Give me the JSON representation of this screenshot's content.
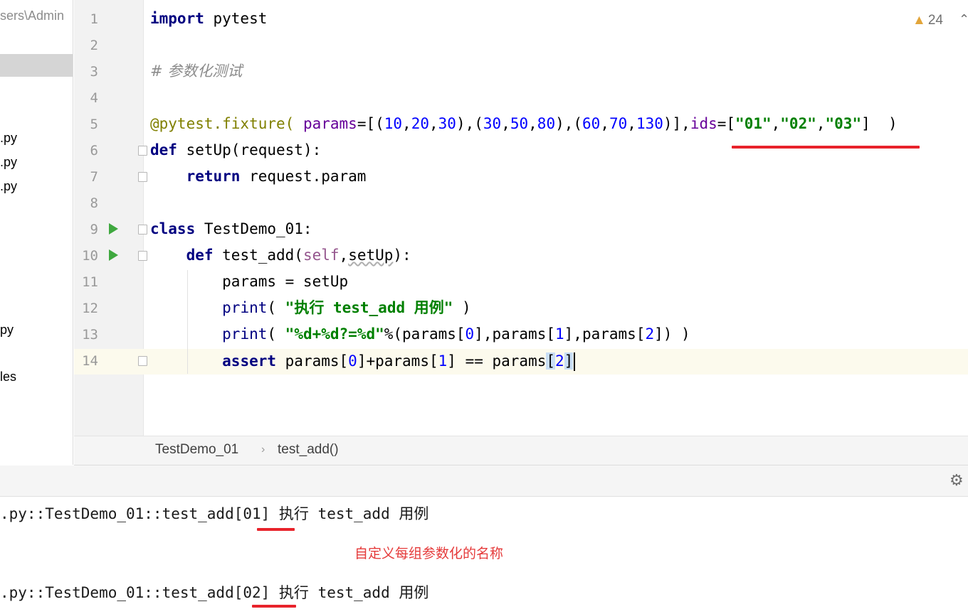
{
  "sidebar": {
    "path": "sers\\Admin",
    "items": [
      ".py",
      ".py",
      ".py",
      "py",
      "les"
    ]
  },
  "editor": {
    "line_numbers": [
      "1",
      "2",
      "3",
      "4",
      "5",
      "6",
      "7",
      "8",
      "9",
      "10",
      "11",
      "12",
      "13",
      "14"
    ],
    "code": {
      "line1": [
        "import",
        " pytest"
      ],
      "line3": "# 参数化测试",
      "line5": [
        "@pytest.fixture(",
        " params",
        "=[(",
        "10",
        ",",
        "20",
        ",",
        "30",
        "),(",
        "30",
        ",",
        "50",
        ",",
        "80",
        "),(",
        "60",
        ",",
        "70",
        ",",
        "130",
        ")],",
        "ids",
        "=[",
        "\"01\"",
        ",",
        "\"02\"",
        ",",
        "\"03\"",
        "]",
        "  )"
      ],
      "line6": [
        "def",
        " setUp(request):"
      ],
      "line7": [
        "    ",
        "return",
        " request.param"
      ],
      "line9": [
        "class",
        " TestDemo_01:"
      ],
      "line10": [
        "    ",
        "def",
        " test_add(",
        "self",
        ",",
        "setUp",
        "):"
      ],
      "line11": "        params = setUp",
      "line12": [
        "        ",
        "print",
        "( ",
        "\"执行 test_add 用例\"",
        " )"
      ],
      "line13": [
        "        ",
        "print",
        "( ",
        "\"%d+%d?=%d\"",
        "%(params[",
        "0",
        "],params[",
        "1",
        "],params[",
        "2",
        "]) )"
      ],
      "line14": [
        "        ",
        "assert",
        " params[",
        "0",
        "]+params[",
        "1",
        "] == params",
        "[",
        "2",
        "]"
      ]
    },
    "warning_count": "24",
    "warning_icon": "warning-triangle-icon",
    "colors": {
      "keyword": "#000080",
      "string": "#008000",
      "number": "#0000ff",
      "decorator": "#808000",
      "comment": "#8c8c8c"
    }
  },
  "breadcrumb": [
    "TestDemo_01",
    "test_add()"
  ],
  "console": {
    "lines": [
      ".py::TestDemo_01::test_add[01] 执行 test_add 用例",
      ".py::TestDemo_01::test_add[02] 执行 test_add 用例"
    ],
    "annotation": "自定义每组参数化的名称",
    "annotation_color": "#e53a3a",
    "settings_icon": "gear-icon"
  }
}
